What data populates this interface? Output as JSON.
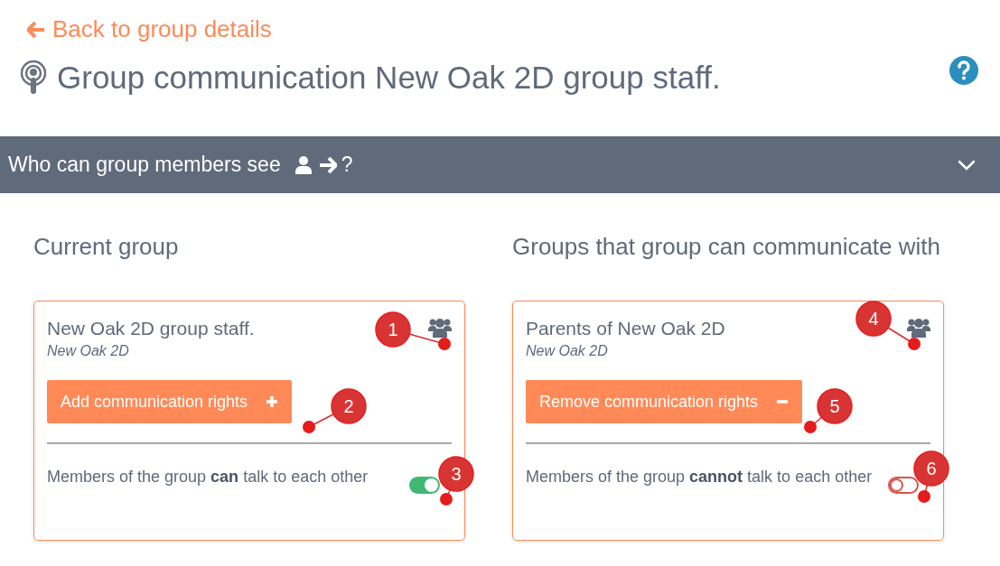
{
  "back_link": {
    "label": "Back to group details"
  },
  "page_title": "Group communication New Oak 2D group staff.",
  "section_bar": {
    "title": "Who can group members see",
    "suffix": "?"
  },
  "columns": [
    {
      "heading": "Current group",
      "card": {
        "title": "New Oak 2D group staff.",
        "subtitle": "New Oak 2D",
        "button": {
          "label": "Add communication rights",
          "kind": "add"
        },
        "toggle_text": "Members of the group **can** talk to each other",
        "toggle_on": true,
        "callouts": [
          "1",
          "2",
          "3"
        ]
      }
    },
    {
      "heading": "Groups that group can communicate with",
      "card": {
        "title": "Parents of New Oak 2D",
        "subtitle": "New Oak 2D",
        "button": {
          "label": "Remove communication rights",
          "kind": "remove"
        },
        "toggle_text": "Members of the group **cannot** talk to each other",
        "toggle_on": false,
        "callouts": [
          "4",
          "5",
          "6"
        ]
      }
    }
  ]
}
